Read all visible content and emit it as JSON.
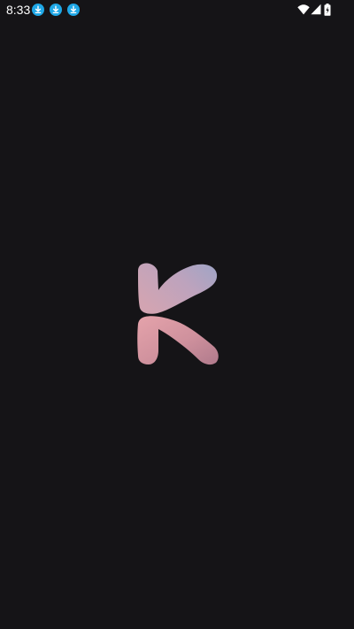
{
  "status_bar": {
    "time": "8:33",
    "notification_icons": [
      "download-icon",
      "download-icon",
      "download-icon"
    ],
    "system_icons": [
      "wifi-icon",
      "cell-signal-icon",
      "battery-charging-icon"
    ],
    "notification_color": "#1fa7e6"
  },
  "splash": {
    "background_color": "#151417",
    "logo_icon": "k-logo-icon",
    "logo_colors": [
      "#d2a4b2",
      "#9ea4c6",
      "#e5a3ab",
      "#b07a8c"
    ]
  }
}
